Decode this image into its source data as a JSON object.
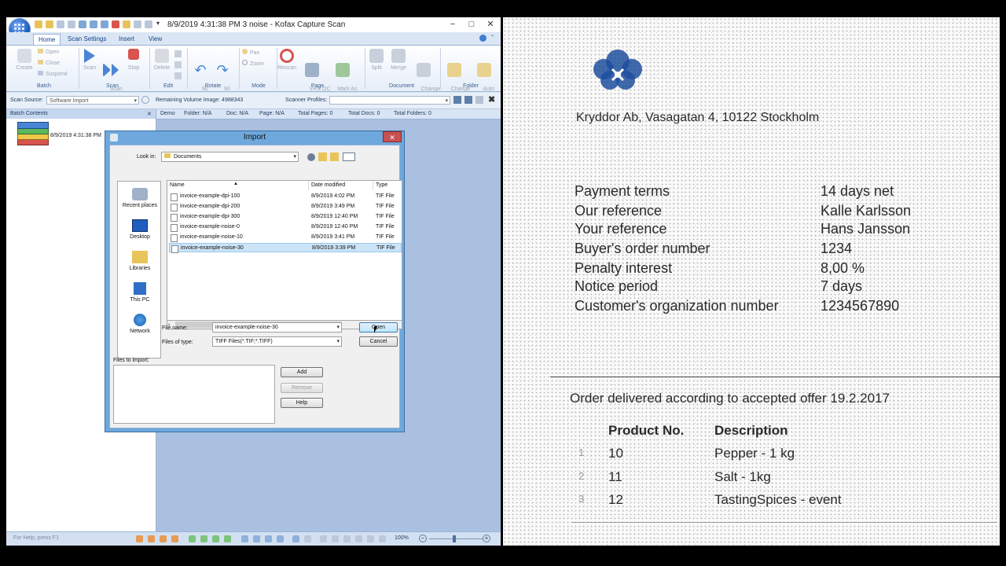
{
  "window": {
    "title": "8/9/2019 4:31:38 PM 3 noise - Kofax Capture Scan",
    "controls": {
      "minimize": "−",
      "maximize": "□",
      "close": "✕"
    }
  },
  "tabs": [
    "Home",
    "Scan Settings",
    "Insert",
    "View"
  ],
  "ribbon": {
    "groups": {
      "batch": {
        "label": "Batch",
        "create": "Create",
        "open": "Open",
        "close": "Close",
        "suspend": "Suspend"
      },
      "scan": {
        "label": "Scan",
        "scan": "Scan",
        "scan_all": "Scan\nAll",
        "stop": "Stop"
      },
      "edit": {
        "label": "Edit",
        "delete": "Delete"
      },
      "rotate": {
        "label": "Rotate",
        "left": "90\nLeft",
        "right": "90\nRight"
      },
      "mode": {
        "label": "Mode",
        "pan": "Pan",
        "zoom": "Zoom"
      },
      "page": {
        "label": "Page",
        "rescan": "Rescan",
        "vrs_qc_later": "VRS QC\nLater",
        "mark_as_non_blank": "Mark As\nNon-blank"
      },
      "document": {
        "label": "Document",
        "split": "Split",
        "merge": "Merge",
        "change_type": "Change\nType"
      },
      "folder": {
        "label": "Folder",
        "change_class": "Change\nClass",
        "auto_foldering": "Auto\nFoldering"
      }
    }
  },
  "source_bar": {
    "scan_source_label": "Scan Source:",
    "scan_source_value": "Software Import",
    "remaining_volume": "Remaining Volume Image: 4988343",
    "scanner_profiles_label": "Scanner Profiles:"
  },
  "batch_contents": {
    "header": "Batch Contents",
    "close": "✕",
    "item_label": "8/9/2019 4:31:38 PM"
  },
  "info_bar": {
    "items": [
      "Demo",
      "Folder: N/A",
      "Doc: N/A",
      "Page: N/A",
      "Total Pages: 0",
      "Total Docs: 0",
      "Total Folders: 0"
    ]
  },
  "status_bar": {
    "help_text": "For Help, press F1",
    "zoom": "100%"
  },
  "dialog": {
    "title": "Import",
    "close": "✕",
    "look_in_label": "Look in:",
    "look_in_value": "Documents",
    "places": [
      "Recent places",
      "Desktop",
      "Libraries",
      "This PC",
      "Network"
    ],
    "columns": [
      "Name",
      "Date modified",
      "Type"
    ],
    "files": [
      {
        "name": "invoice-example-dpi-100",
        "date": "8/9/2019 4:02 PM",
        "type": "TIF File"
      },
      {
        "name": "invoice-example-dpi-200",
        "date": "8/9/2019 3:49 PM",
        "type": "TIF File"
      },
      {
        "name": "invoice-example-dpi-300",
        "date": "8/9/2019 12:40 PM",
        "type": "TIF File"
      },
      {
        "name": "invoice-example-noise-0",
        "date": "8/9/2019 12:40 PM",
        "type": "TIF File"
      },
      {
        "name": "invoice-example-noise-10",
        "date": "8/9/2019 3:41 PM",
        "type": "TIF File"
      },
      {
        "name": "invoice-example-noise-30",
        "date": "8/9/2019 3:39 PM",
        "type": "TIF File"
      }
    ],
    "selected_index": 5,
    "file_name_label": "File name:",
    "file_name_value": "invoice-example-noise-30",
    "files_of_type_label": "Files of type:",
    "files_of_type_value": "TIFF Files(*.TIF;*.TIFF)",
    "open_button": "Open",
    "cancel_button": "Cancel",
    "files_to_import_label": "Files to import:",
    "add_button": "Add",
    "remove_button": "Remove",
    "help_button": "Help"
  },
  "document": {
    "address": "Kryddor Ab, Vasagatan 4, 10122 Stockholm",
    "terms": [
      {
        "label": "Payment terms",
        "value": "14 days net"
      },
      {
        "label": "Our reference",
        "value": "Kalle Karlsson"
      },
      {
        "label": "Your reference",
        "value": "Hans Jansson"
      },
      {
        "label": "Buyer's order number",
        "value": "1234"
      },
      {
        "label": "Penalty interest",
        "value": "8,00 %"
      },
      {
        "label": "Notice period",
        "value": "7 days"
      },
      {
        "label": "Customer's organization number",
        "value": "1234567890"
      }
    ],
    "order_note": "Order delivered according to accepted offer 19.2.2017",
    "table_headers": [
      "Product No.",
      "Description"
    ],
    "rows": [
      {
        "index": "1",
        "product": "10",
        "description": "Pepper - 1 kg"
      },
      {
        "index": "2",
        "product": "11",
        "description": "Salt - 1kg"
      },
      {
        "index": "3",
        "product": "12",
        "description": "TastingSpices - event"
      }
    ]
  },
  "colors": {
    "ribbon_blue": "#15428b",
    "main_area": "#a9c0e0",
    "dialog_frame": "#6ea8dc",
    "selection": "#cce4f7"
  }
}
